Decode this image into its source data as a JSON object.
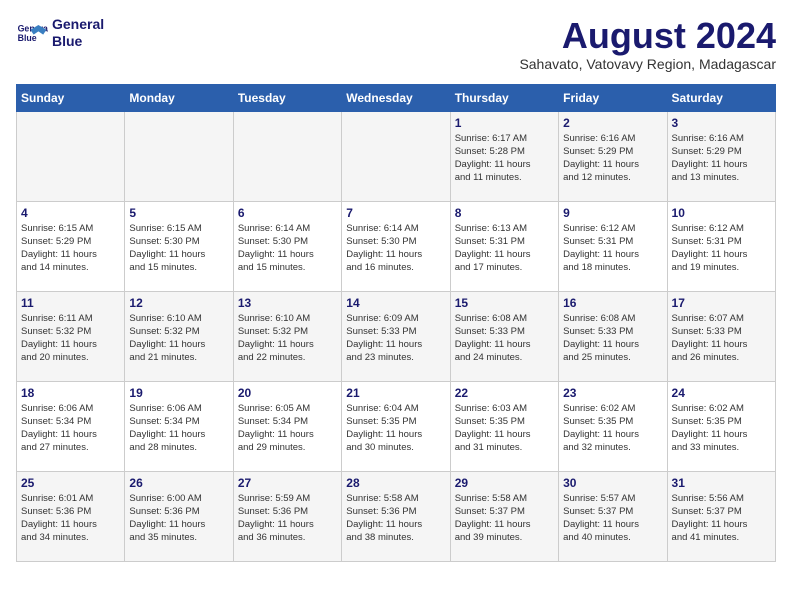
{
  "header": {
    "logo_line1": "General",
    "logo_line2": "Blue",
    "month_year": "August 2024",
    "location": "Sahavato, Vatovavy Region, Madagascar"
  },
  "days_of_week": [
    "Sunday",
    "Monday",
    "Tuesday",
    "Wednesday",
    "Thursday",
    "Friday",
    "Saturday"
  ],
  "weeks": [
    [
      {
        "day": "",
        "info": ""
      },
      {
        "day": "",
        "info": ""
      },
      {
        "day": "",
        "info": ""
      },
      {
        "day": "",
        "info": ""
      },
      {
        "day": "1",
        "info": "Sunrise: 6:17 AM\nSunset: 5:28 PM\nDaylight: 11 hours\nand 11 minutes."
      },
      {
        "day": "2",
        "info": "Sunrise: 6:16 AM\nSunset: 5:29 PM\nDaylight: 11 hours\nand 12 minutes."
      },
      {
        "day": "3",
        "info": "Sunrise: 6:16 AM\nSunset: 5:29 PM\nDaylight: 11 hours\nand 13 minutes."
      }
    ],
    [
      {
        "day": "4",
        "info": "Sunrise: 6:15 AM\nSunset: 5:29 PM\nDaylight: 11 hours\nand 14 minutes."
      },
      {
        "day": "5",
        "info": "Sunrise: 6:15 AM\nSunset: 5:30 PM\nDaylight: 11 hours\nand 15 minutes."
      },
      {
        "day": "6",
        "info": "Sunrise: 6:14 AM\nSunset: 5:30 PM\nDaylight: 11 hours\nand 15 minutes."
      },
      {
        "day": "7",
        "info": "Sunrise: 6:14 AM\nSunset: 5:30 PM\nDaylight: 11 hours\nand 16 minutes."
      },
      {
        "day": "8",
        "info": "Sunrise: 6:13 AM\nSunset: 5:31 PM\nDaylight: 11 hours\nand 17 minutes."
      },
      {
        "day": "9",
        "info": "Sunrise: 6:12 AM\nSunset: 5:31 PM\nDaylight: 11 hours\nand 18 minutes."
      },
      {
        "day": "10",
        "info": "Sunrise: 6:12 AM\nSunset: 5:31 PM\nDaylight: 11 hours\nand 19 minutes."
      }
    ],
    [
      {
        "day": "11",
        "info": "Sunrise: 6:11 AM\nSunset: 5:32 PM\nDaylight: 11 hours\nand 20 minutes."
      },
      {
        "day": "12",
        "info": "Sunrise: 6:10 AM\nSunset: 5:32 PM\nDaylight: 11 hours\nand 21 minutes."
      },
      {
        "day": "13",
        "info": "Sunrise: 6:10 AM\nSunset: 5:32 PM\nDaylight: 11 hours\nand 22 minutes."
      },
      {
        "day": "14",
        "info": "Sunrise: 6:09 AM\nSunset: 5:33 PM\nDaylight: 11 hours\nand 23 minutes."
      },
      {
        "day": "15",
        "info": "Sunrise: 6:08 AM\nSunset: 5:33 PM\nDaylight: 11 hours\nand 24 minutes."
      },
      {
        "day": "16",
        "info": "Sunrise: 6:08 AM\nSunset: 5:33 PM\nDaylight: 11 hours\nand 25 minutes."
      },
      {
        "day": "17",
        "info": "Sunrise: 6:07 AM\nSunset: 5:33 PM\nDaylight: 11 hours\nand 26 minutes."
      }
    ],
    [
      {
        "day": "18",
        "info": "Sunrise: 6:06 AM\nSunset: 5:34 PM\nDaylight: 11 hours\nand 27 minutes."
      },
      {
        "day": "19",
        "info": "Sunrise: 6:06 AM\nSunset: 5:34 PM\nDaylight: 11 hours\nand 28 minutes."
      },
      {
        "day": "20",
        "info": "Sunrise: 6:05 AM\nSunset: 5:34 PM\nDaylight: 11 hours\nand 29 minutes."
      },
      {
        "day": "21",
        "info": "Sunrise: 6:04 AM\nSunset: 5:35 PM\nDaylight: 11 hours\nand 30 minutes."
      },
      {
        "day": "22",
        "info": "Sunrise: 6:03 AM\nSunset: 5:35 PM\nDaylight: 11 hours\nand 31 minutes."
      },
      {
        "day": "23",
        "info": "Sunrise: 6:02 AM\nSunset: 5:35 PM\nDaylight: 11 hours\nand 32 minutes."
      },
      {
        "day": "24",
        "info": "Sunrise: 6:02 AM\nSunset: 5:35 PM\nDaylight: 11 hours\nand 33 minutes."
      }
    ],
    [
      {
        "day": "25",
        "info": "Sunrise: 6:01 AM\nSunset: 5:36 PM\nDaylight: 11 hours\nand 34 minutes."
      },
      {
        "day": "26",
        "info": "Sunrise: 6:00 AM\nSunset: 5:36 PM\nDaylight: 11 hours\nand 35 minutes."
      },
      {
        "day": "27",
        "info": "Sunrise: 5:59 AM\nSunset: 5:36 PM\nDaylight: 11 hours\nand 36 minutes."
      },
      {
        "day": "28",
        "info": "Sunrise: 5:58 AM\nSunset: 5:36 PM\nDaylight: 11 hours\nand 38 minutes."
      },
      {
        "day": "29",
        "info": "Sunrise: 5:58 AM\nSunset: 5:37 PM\nDaylight: 11 hours\nand 39 minutes."
      },
      {
        "day": "30",
        "info": "Sunrise: 5:57 AM\nSunset: 5:37 PM\nDaylight: 11 hours\nand 40 minutes."
      },
      {
        "day": "31",
        "info": "Sunrise: 5:56 AM\nSunset: 5:37 PM\nDaylight: 11 hours\nand 41 minutes."
      }
    ]
  ]
}
